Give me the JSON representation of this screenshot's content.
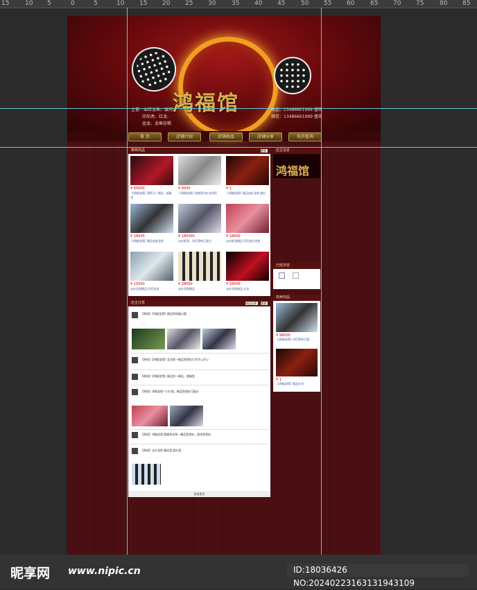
{
  "ruler": [
    "15",
    "10",
    "5",
    "0",
    "5",
    "10",
    "15",
    "20",
    "25",
    "30",
    "35",
    "40",
    "45",
    "50",
    "55",
    "60",
    "65",
    "70",
    "75",
    "80",
    "85"
  ],
  "brand": {
    "title": "鸿福馆"
  },
  "header": {
    "main_label": "主营：血红龙鱼、银河、",
    "main_line2": "印尼虎、红龙、",
    "main_line3": "金龙、龙鱼珍稀",
    "tel": "电话：13486601999 盛琪",
    "tel2": "微信：13486601999 盛琪"
  },
  "nav": [
    "首 页",
    "店铺介绍",
    "店铺商品",
    "店铺分享",
    "先开查询"
  ],
  "recommend": {
    "title": "推荐商品",
    "more": "更多",
    "items": [
      {
        "price": "¥ 65000",
        "cap": "【鸿福龙馆】酒罗汉一格后...超级龙"
      },
      {
        "price": "¥ 4500",
        "cap": "【鸿福龙馆】银底黑点红龙吊形"
      },
      {
        "price": "¥ 1",
        "cap": "【鸿福龙馆】精品血红龙鱼 超红"
      },
      {
        "price": "¥ 28000",
        "cap": "【鸿福龙馆】精品虎皮龙鱼"
      },
      {
        "price": "¥ 180000",
        "cap": "淡水魟鱼、印尼黑帝王星点"
      },
      {
        "price": "¥ 18000",
        "cap": "淡水魟鱼精品 印尼血红龙鱼"
      },
      {
        "price": "¥ 15000",
        "cap": "淡水龙鱼精品 印尼金龙"
      },
      {
        "price": "¥ 28000",
        "cap": "淡水龙鱼精品"
      },
      {
        "price": "¥ 16000",
        "cap": "淡水龙鱼精品 红龙"
      }
    ]
  },
  "share": {
    "title": "店主分享",
    "tab": "网店分享",
    "more": "更多",
    "posts": [
      "【原创】【鸿福龙馆】精品鱼场展示图",
      "【原创】【鸿福龙馆】金龙鱼一精品鱼鱼缸打开开心开心",
      "【原创】【鸿福龙馆】精品鱼一精品，超级鱼",
      "【原创】鸿福龙馆一口口鱼，精品鱼鱼缸可展示",
      "【原创】鸿福龙馆 超级鱼龙鱼一精品鱼鱼缸，超龙鱼鱼缸",
      "【原创】淡水龙鱼 精品鱼 超红鱼"
    ],
    "footer": "查看更多"
  },
  "right": {
    "shop_title": "店主信息",
    "shop_label": "鸿福馆",
    "visit_title": "已经浏览",
    "hot_title": "热卖商品",
    "hot_price1": "¥ 98000",
    "hot_cap1": "【鸿福龙馆】印尼黑帝王超",
    "hot_price2": "¥ 1",
    "hot_cap2": "【鸿福龙馆】精品红龙"
  },
  "watermark": {
    "logo": "昵享网",
    "url": "www.nipic.cn",
    "id": "ID:18036426 NO:20240223163131943109"
  }
}
